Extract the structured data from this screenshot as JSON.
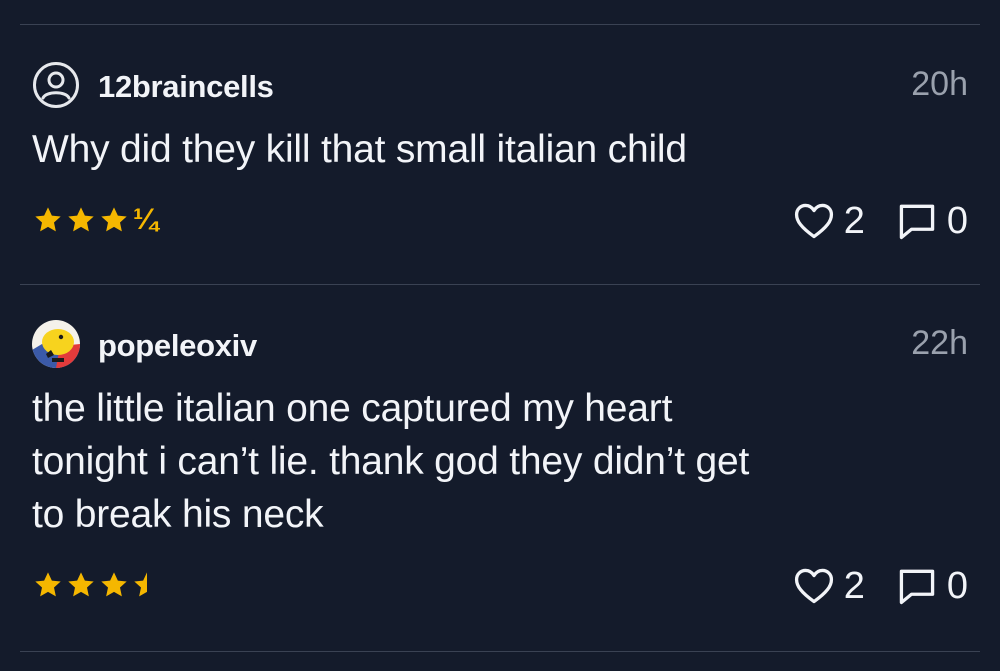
{
  "colors": {
    "background": "#141b2b",
    "divider": "#3a4253",
    "star": "#f5b700",
    "muted": "#9aa1ad",
    "text": "#f2f4f8"
  },
  "reviews": [
    {
      "username": "12braincells",
      "time": "20h",
      "text": "Why did they kill that small italian child",
      "rating": 3.25,
      "rating_fraction_label": "¼",
      "likes": "2",
      "comments": "0",
      "avatar": "default-user-icon"
    },
    {
      "username": "popeleoxiv",
      "time": "22h",
      "text": "the little italian one captured my heart\ntonight i can’t lie. thank god they didn’t get\nto break his neck",
      "rating": 3.5,
      "likes": "2",
      "comments": "0",
      "avatar": "yellow-cartoon-avatar"
    }
  ]
}
